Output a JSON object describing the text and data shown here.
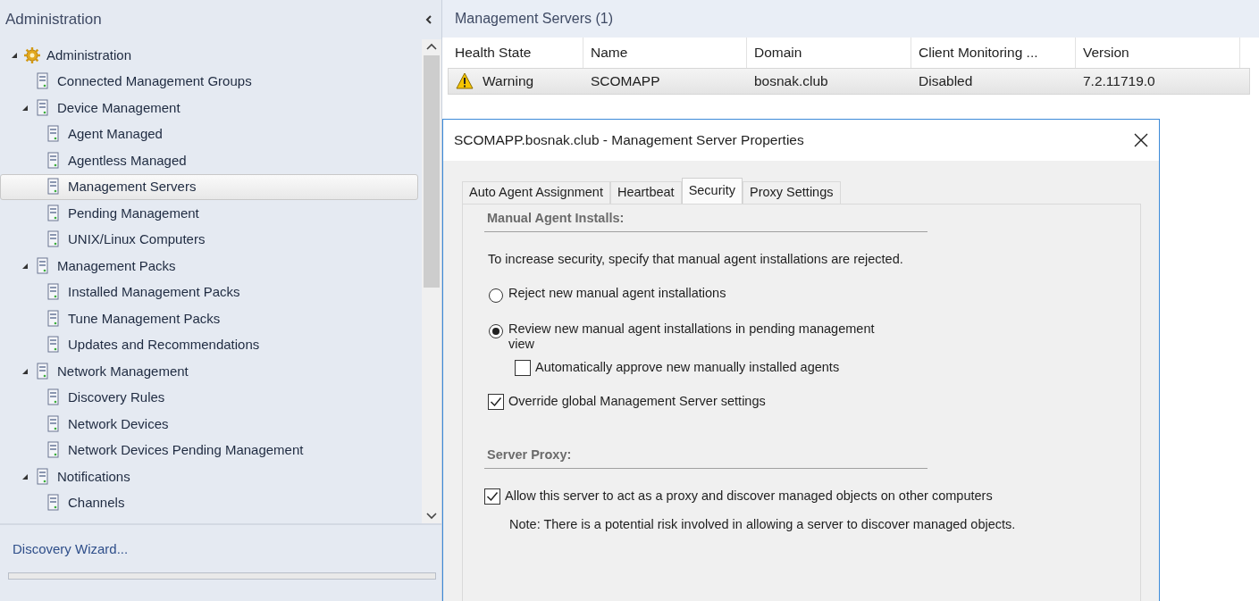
{
  "pane": {
    "title": "Administration"
  },
  "tree": [
    {
      "label": "Administration",
      "expanded": true,
      "selected": false,
      "children": [
        {
          "label": "Connected Management Groups",
          "selected": false
        },
        {
          "label": "Device Management",
          "expanded": true,
          "selected": false,
          "children": [
            {
              "label": "Agent Managed",
              "selected": false
            },
            {
              "label": "Agentless Managed",
              "selected": false
            },
            {
              "label": "Management Servers",
              "selected": true
            },
            {
              "label": "Pending Management",
              "selected": false
            },
            {
              "label": "UNIX/Linux Computers",
              "selected": false
            }
          ]
        },
        {
          "label": "Management Packs",
          "expanded": true,
          "selected": false,
          "children": [
            {
              "label": "Installed Management Packs",
              "selected": false
            },
            {
              "label": "Tune Management Packs",
              "selected": false
            },
            {
              "label": "Updates and Recommendations",
              "selected": false
            }
          ]
        },
        {
          "label": "Network Management",
          "expanded": true,
          "selected": false,
          "children": [
            {
              "label": "Discovery Rules",
              "selected": false
            },
            {
              "label": "Network Devices",
              "selected": false
            },
            {
              "label": "Network Devices Pending Management",
              "selected": false
            }
          ]
        },
        {
          "label": "Notifications",
          "expanded": true,
          "selected": false,
          "children": [
            {
              "label": "Channels",
              "selected": false
            }
          ]
        }
      ]
    }
  ],
  "tasks": [
    "Discovery Wizard..."
  ],
  "list": {
    "title": "Management Servers (1)",
    "columns": [
      "Health State",
      "Name",
      "Domain",
      "Client Monitoring ...",
      "Version"
    ],
    "rows": [
      {
        "selected": true,
        "cells": [
          "Warning",
          "SCOMAPP",
          "bosnak.club",
          "Disabled",
          "7.2.11719.0"
        ]
      }
    ]
  },
  "dialog": {
    "title": "SCOMAPP.bosnak.club - Management Server Properties",
    "tabs": [
      {
        "label": "Auto Agent Assignment",
        "selected": false
      },
      {
        "label": "Heartbeat",
        "selected": false
      },
      {
        "label": "Security",
        "selected": true
      },
      {
        "label": "Proxy Settings",
        "selected": false
      }
    ],
    "sections": [
      {
        "heading": "Manual Agent Installs:",
        "items": [
          {
            "kind": "text",
            "text": "To increase security, specify that manual agent installations are rejected."
          },
          {
            "kind": "radio",
            "label": "Reject new manual agent installations",
            "selected": false
          },
          {
            "kind": "radio",
            "label": "Review new manual agent installations in pending management view",
            "selected": true,
            "children": [
              {
                "kind": "checkbox",
                "label": "Automatically approve new manually installed agents",
                "checked": false
              }
            ]
          },
          {
            "kind": "checkbox",
            "label": "Override global Management Server settings",
            "checked": true
          }
        ]
      },
      {
        "heading": "Server Proxy:",
        "items": [
          {
            "kind": "checkbox",
            "label": "Allow this server to act as a proxy and discover managed objects on other computers",
            "checked": true,
            "children": [
              {
                "kind": "text",
                "text": "Note: There is a potential risk involved in allowing a server to discover managed objects."
              }
            ]
          }
        ]
      }
    ]
  }
}
